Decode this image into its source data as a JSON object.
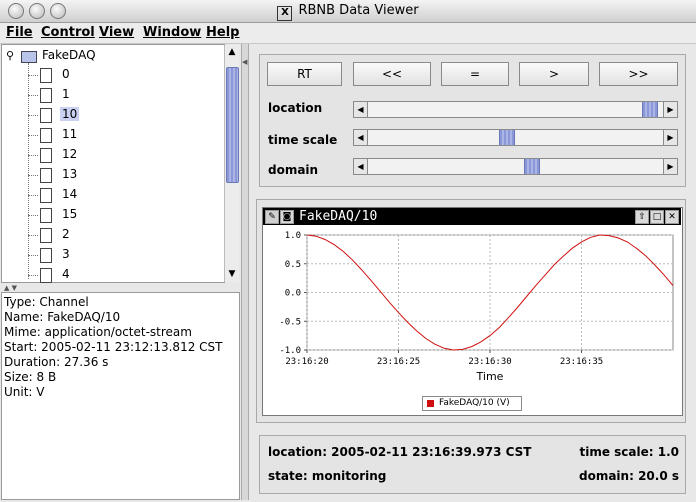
{
  "window": {
    "title": "RBNB Data Viewer"
  },
  "menu": [
    "File",
    "Control",
    "View",
    "Window",
    "Help"
  ],
  "tree": {
    "root": "FakeDAQ",
    "items": [
      "0",
      "1",
      "10",
      "11",
      "12",
      "13",
      "14",
      "15",
      "2",
      "3",
      "4"
    ],
    "selected": "10"
  },
  "info": [
    "Type: Channel",
    "Name: FakeDAQ/10",
    "Mime: application/octet-stream",
    "Start: 2005-02-11 23:12:13.812 CST",
    "Duration: 27.36 s",
    "Size: 8 B",
    "Unit: V"
  ],
  "controls": {
    "buttons": [
      "RT",
      "<<",
      "=",
      ">",
      ">>"
    ],
    "sliders": [
      {
        "label": "location",
        "value": 0.98
      },
      {
        "label": "time scale",
        "value": 0.47
      },
      {
        "label": "domain",
        "value": 0.56
      }
    ]
  },
  "chart_panel": {
    "title": "FakeDAQ/10"
  },
  "chart_data": {
    "type": "line",
    "xlabel": "Time",
    "ylabel": "",
    "x_ticks": [
      "23:16:20",
      "23:16:25",
      "23:16:30",
      "23:16:35"
    ],
    "y_ticks": [
      "1.0",
      "0.5",
      "0.0",
      "-0.5",
      "-1.0"
    ],
    "ylim": [
      -1.0,
      1.0
    ],
    "xlim_seconds": [
      0,
      20
    ],
    "grid": true,
    "legend_position": "bottom-center",
    "series": [
      {
        "name": "FakeDAQ/10 (V)",
        "color": "#d01010",
        "x": [
          0,
          0.5,
          1,
          1.5,
          2,
          2.5,
          3,
          3.5,
          4,
          4.5,
          5,
          5.5,
          6,
          6.5,
          7,
          7.5,
          8,
          8.5,
          9,
          9.5,
          10,
          10.5,
          11,
          11.5,
          12,
          12.5,
          13,
          13.5,
          14,
          14.5,
          15,
          15.5,
          16,
          16.5,
          17,
          17.5,
          18,
          18.5,
          19,
          19.5,
          20
        ],
        "values": [
          1.0,
          0.98,
          0.92,
          0.83,
          0.71,
          0.56,
          0.39,
          0.21,
          0.02,
          -0.17,
          -0.35,
          -0.52,
          -0.67,
          -0.8,
          -0.9,
          -0.97,
          -1.0,
          -0.99,
          -0.94,
          -0.86,
          -0.75,
          -0.61,
          -0.44,
          -0.26,
          -0.07,
          0.12,
          0.3,
          0.48,
          0.63,
          0.77,
          0.88,
          0.96,
          1.0,
          0.99,
          0.95,
          0.88,
          0.77,
          0.64,
          0.48,
          0.31,
          0.12
        ]
      }
    ]
  },
  "status": {
    "location": "location: 2005-02-11 23:16:39.973 CST",
    "time_scale": "time scale: 1.0",
    "state": "state: monitoring",
    "domain": "domain: 20.0 s"
  },
  "colors": {
    "selection": "#c9d0f2",
    "scroll_thumb": "#8a98d8",
    "series": "#d01010",
    "header": "#000000"
  }
}
